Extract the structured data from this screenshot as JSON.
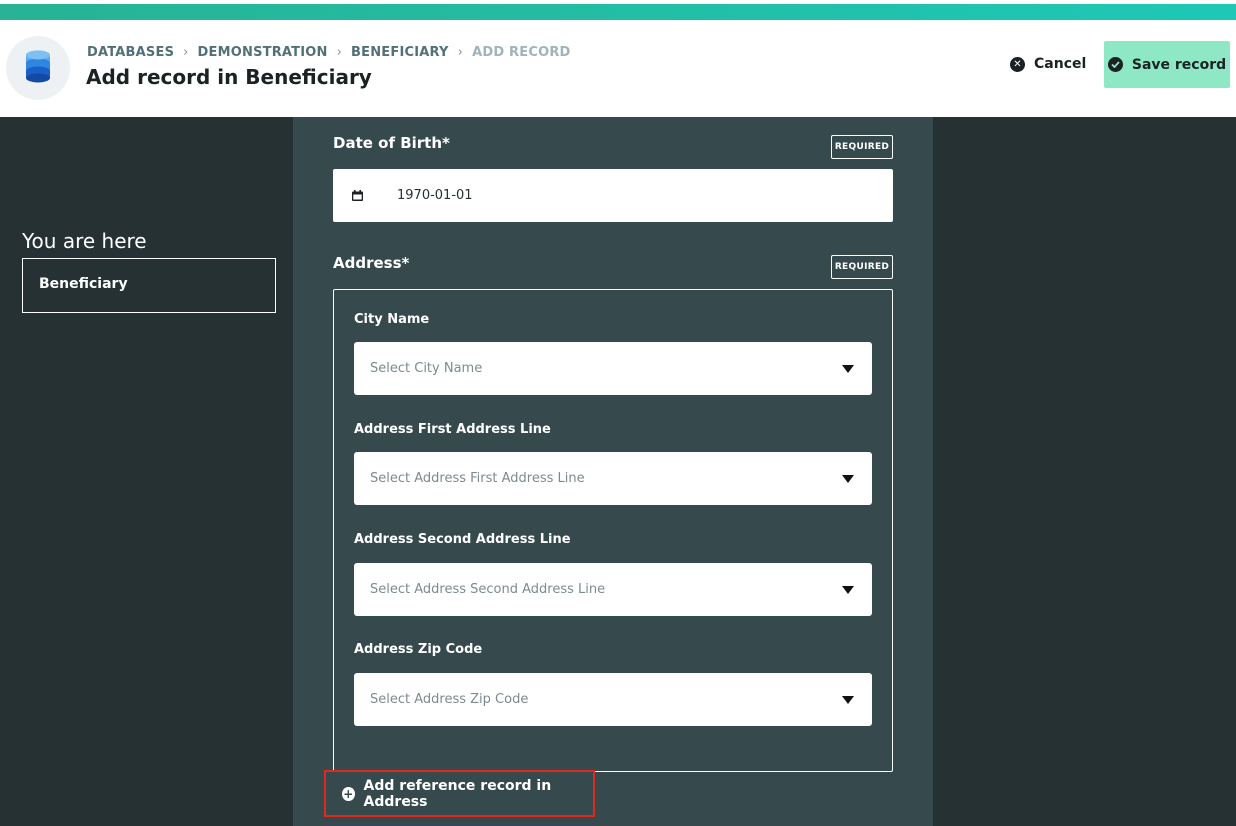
{
  "breadcrumb": {
    "items": [
      "DATABASES",
      "DEMONSTRATION",
      "BENEFICIARY",
      "ADD RECORD"
    ]
  },
  "header": {
    "title": "Add record in Beneficiary",
    "cancel_label": "Cancel",
    "save_label": "Save record"
  },
  "sidebar": {
    "heading": "You are here",
    "current": "Beneficiary"
  },
  "form": {
    "dob": {
      "label": "Date of Birth*",
      "badge": "REQUIRED",
      "value": "1970-01-01"
    },
    "address": {
      "label": "Address*",
      "badge": "REQUIRED",
      "fields": [
        {
          "label": "City Name",
          "placeholder": "Select City Name"
        },
        {
          "label": "Address First Address Line",
          "placeholder": "Select Address First Address Line"
        },
        {
          "label": "Address Second Address Line",
          "placeholder": "Select Address Second Address Line"
        },
        {
          "label": "Address Zip Code",
          "placeholder": "Select Address Zip Code"
        }
      ],
      "add_reference_label": "Add reference record in Address"
    }
  },
  "colors": {
    "accent": "#1ec8b6",
    "save_button": "#8ee8c6",
    "form_bg": "#364a4d",
    "page_bg": "#263133",
    "highlight": "#e0281c"
  }
}
